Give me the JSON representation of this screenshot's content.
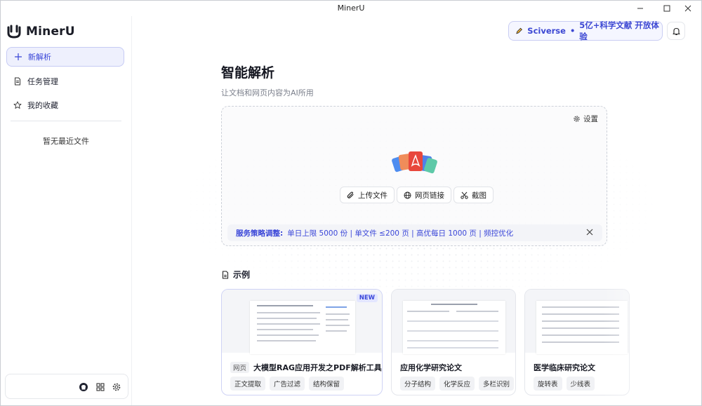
{
  "window": {
    "title": "MinerU"
  },
  "sidebar": {
    "logo_text": "MinerU",
    "items": [
      {
        "label": "新解析",
        "icon": "plus-icon"
      },
      {
        "label": "任务管理",
        "icon": "document-icon"
      },
      {
        "label": "我的收藏",
        "icon": "star-icon"
      }
    ],
    "empty_recent": "暂无最近文件",
    "footer_icons": [
      "github-icon",
      "grid-icon",
      "gear-icon"
    ]
  },
  "header": {
    "promo_brand": "Sciverse",
    "promo_sep": "•",
    "promo_text": "5亿+科学文献 开放体验"
  },
  "main": {
    "title": "智能解析",
    "subtitle": "让文档和网页内容为AI所用",
    "settings_label": "设置",
    "buttons": {
      "upload": "上传文件",
      "web_link": "网页链接",
      "screenshot": "截图"
    },
    "notice": {
      "prefix": "服务策略调整:",
      "text": "单日上限 5000 份 | 单文件 ≤200 页 | 高优每日 1000 页 | 频控优化"
    },
    "examples_title": "示例",
    "examples": [
      {
        "badge": "NEW",
        "type": "网页",
        "title": "大模型RAG应用开发之PDF解析工具对比",
        "tags": [
          "正文提取",
          "广告过滤",
          "结构保留"
        ]
      },
      {
        "title": "应用化学研究论文",
        "tags": [
          "分子结构",
          "化学反应",
          "多栏识别"
        ]
      },
      {
        "title": "医学临床研究论文",
        "tags": [
          "旋转表",
          "少线表"
        ]
      }
    ]
  },
  "colors": {
    "accent": "#3a46d8",
    "accent_bg": "#eef0fd"
  }
}
